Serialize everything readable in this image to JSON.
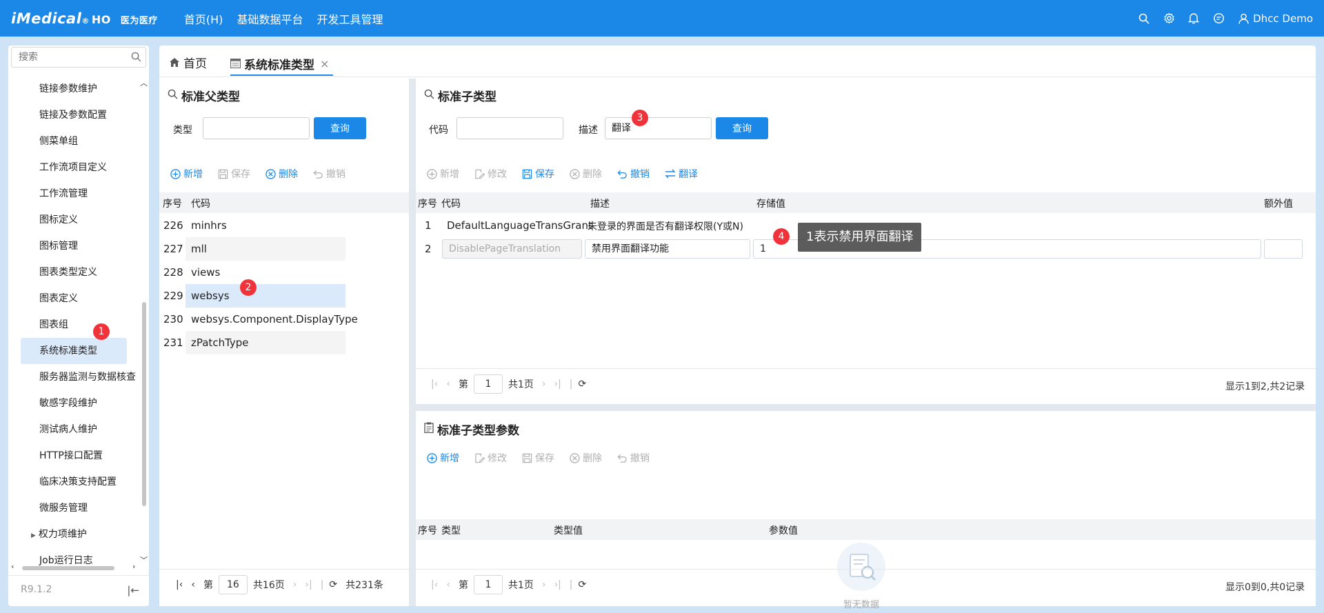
{
  "header": {
    "logo_main": "iMedical",
    "logo_reg": "®",
    "logo_ho": "HO",
    "logo_brand": "医为医疗",
    "nav": [
      "首页(H)",
      "基础数据平台",
      "开发工具管理"
    ],
    "user": "Dhcc Demo",
    "icons": [
      "search-icon",
      "gear-icon",
      "bell-icon",
      "message-icon",
      "user-icon"
    ]
  },
  "sidebar": {
    "search_placeholder": "搜索",
    "items": [
      "链接参数维护",
      "链接及参数配置",
      "侧菜单组",
      "工作流项目定义",
      "工作流管理",
      "图标定义",
      "图标管理",
      "图表类型定义",
      "图表定义",
      "图表组",
      "系统标准类型",
      "服务器监测与数据核查",
      "敏感字段维护",
      "测试病人维护",
      "HTTP接口配置",
      "临床决策支持配置",
      "微服务管理",
      "权力项维护",
      "Job运行日志"
    ],
    "active_index": 10,
    "version": "R9.1.2"
  },
  "tabs": {
    "home": "首页",
    "current": "系统标准类型",
    "close": "×"
  },
  "parent_panel": {
    "title": "标准父类型",
    "type_label": "类型",
    "type_value": "",
    "query": "查询",
    "toolbar": [
      "新增",
      "保存",
      "删除",
      "撤销"
    ],
    "columns": [
      "序号",
      "代码"
    ],
    "rows": [
      {
        "no": "226",
        "code": "minhrs"
      },
      {
        "no": "227",
        "code": "mll"
      },
      {
        "no": "228",
        "code": "views"
      },
      {
        "no": "229",
        "code": "websys"
      },
      {
        "no": "230",
        "code": "websys.Component.DisplayType"
      },
      {
        "no": "231",
        "code": "zPatchType"
      }
    ],
    "selected_no": "229",
    "pager": {
      "page_label": "第",
      "page": "16",
      "total_pages": "共16页",
      "total": "共231条"
    }
  },
  "child_panel": {
    "title": "标准子类型",
    "code_label": "代码",
    "code_value": "",
    "desc_label": "描述",
    "desc_value": "翻译",
    "query": "查询",
    "toolbar": [
      "新增",
      "修改",
      "保存",
      "删除",
      "撤销",
      "翻译"
    ],
    "columns": [
      "序号",
      "代码",
      "描述",
      "存储值",
      "额外值"
    ],
    "rows": [
      {
        "no": "1",
        "code": "DefaultLanguageTransGrant",
        "desc": "未登录的界面是否有翻译权限(Y或N)",
        "value": "",
        "extra": ""
      },
      {
        "no": "2",
        "code": "DisablePageTranslation",
        "desc": "禁用界面翻译功能",
        "value": "1",
        "extra": ""
      }
    ],
    "pager": {
      "page_label": "第",
      "page": "1",
      "total_pages": "共1页",
      "summary": "显示1到2,共2记录"
    }
  },
  "param_panel": {
    "title": "标准子类型参数",
    "toolbar": [
      "新增",
      "修改",
      "保存",
      "删除",
      "撤销"
    ],
    "columns": [
      "序号",
      "类型",
      "类型值",
      "参数值"
    ],
    "empty": "暂无数据",
    "pager": {
      "page_label": "第",
      "page": "1",
      "total_pages": "共1页",
      "summary": "显示0到0,共0记录"
    }
  },
  "annotations": {
    "b1": "1",
    "b2": "2",
    "b3": "3",
    "b4": "4",
    "tooltip": "1表示禁用界面翻译"
  },
  "colors": {
    "accent": "#1b87e6",
    "badge": "#f0333a",
    "selected_row": "#dbeafb"
  }
}
